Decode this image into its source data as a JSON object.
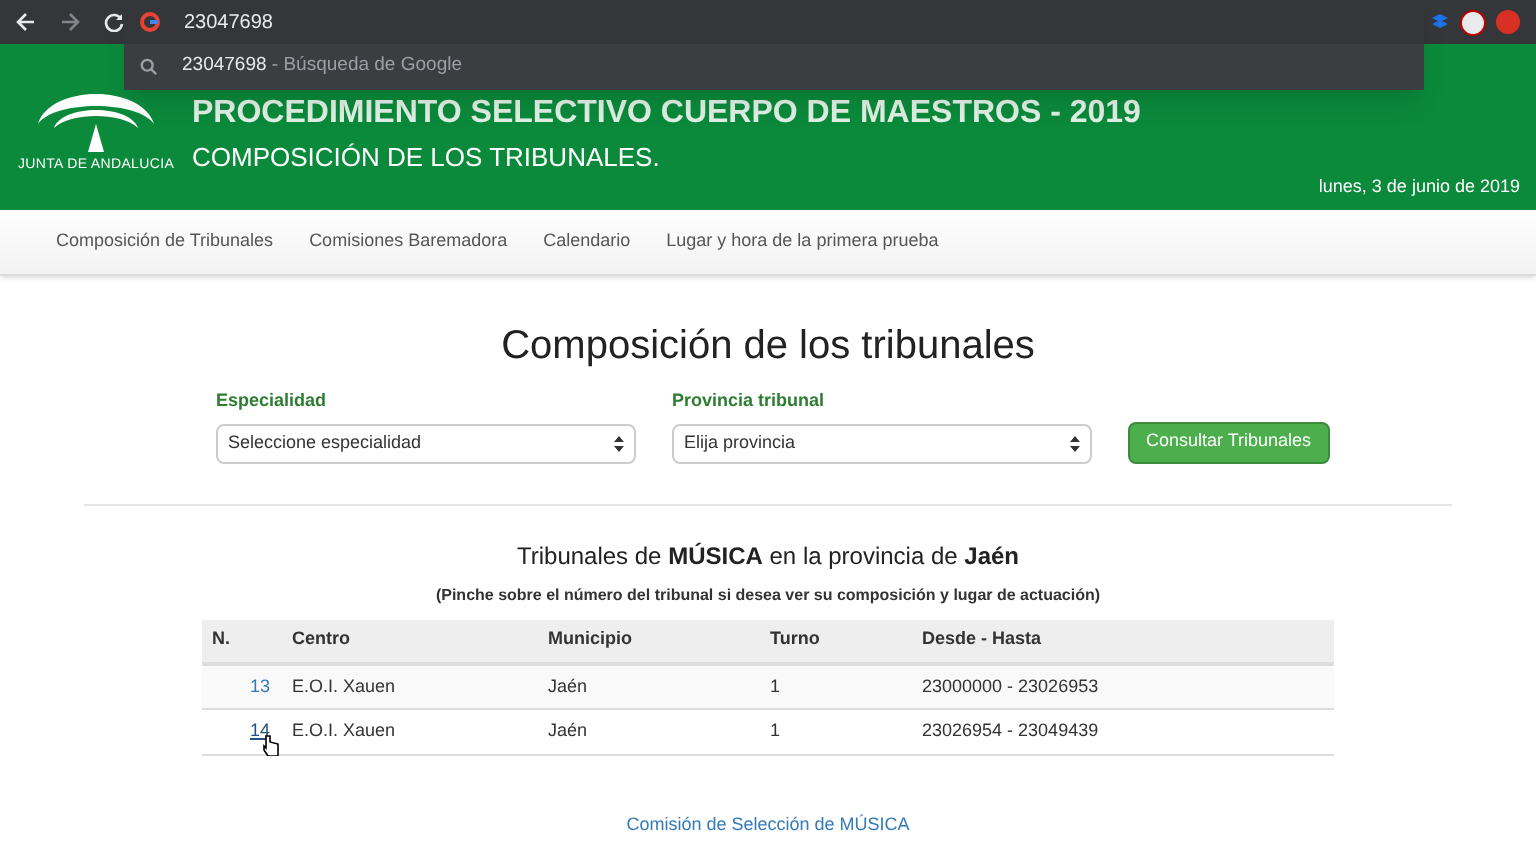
{
  "browser": {
    "address": "23047698",
    "suggestion": {
      "query": "23047698",
      "source": "- Búsqueda de Google"
    }
  },
  "header": {
    "logo_text": "JUNTA DE ANDALUCIA",
    "title": "PROCEDIMIENTO SELECTIVO CUERPO DE MAESTROS - 2019",
    "subtitle": "COMPOSICIÓN DE LOS TRIBUNALES.",
    "date": "lunes, 3 de junio de 2019"
  },
  "nav": [
    "Composición de Tribunales",
    "Comisiones Baremadora",
    "Calendario",
    "Lugar y hora de la primera prueba"
  ],
  "page_title": "Composición de los tribunales",
  "form": {
    "fields": [
      {
        "label": "Especialidad",
        "value": "Seleccione especialidad"
      },
      {
        "label": "Provincia tribunal",
        "value": "Elija provincia"
      }
    ],
    "button": "Consultar Tribunales"
  },
  "results": {
    "heading": "Tribunales de **MÚSICA** en la provincia de **Jaén**",
    "note": "(Pinche sobre el número del tribunal si desea ver su composición y lugar de actuación)",
    "columns": [
      "N.",
      "Centro",
      "Municipio",
      "Turno",
      "Desde - Hasta"
    ],
    "rows": [
      {
        "n": "13",
        "centro": "E.O.I. Xauen",
        "municipio": "Jaén",
        "turno": "1",
        "rango": "23000000 - 23026953",
        "hovered": false
      },
      {
        "n": "14",
        "centro": "E.O.I. Xauen",
        "municipio": "Jaén",
        "turno": "1",
        "rango": "23026954 - 23049439",
        "hovered": true
      }
    ],
    "link": "Comisión de Selección de MÚSICA"
  }
}
